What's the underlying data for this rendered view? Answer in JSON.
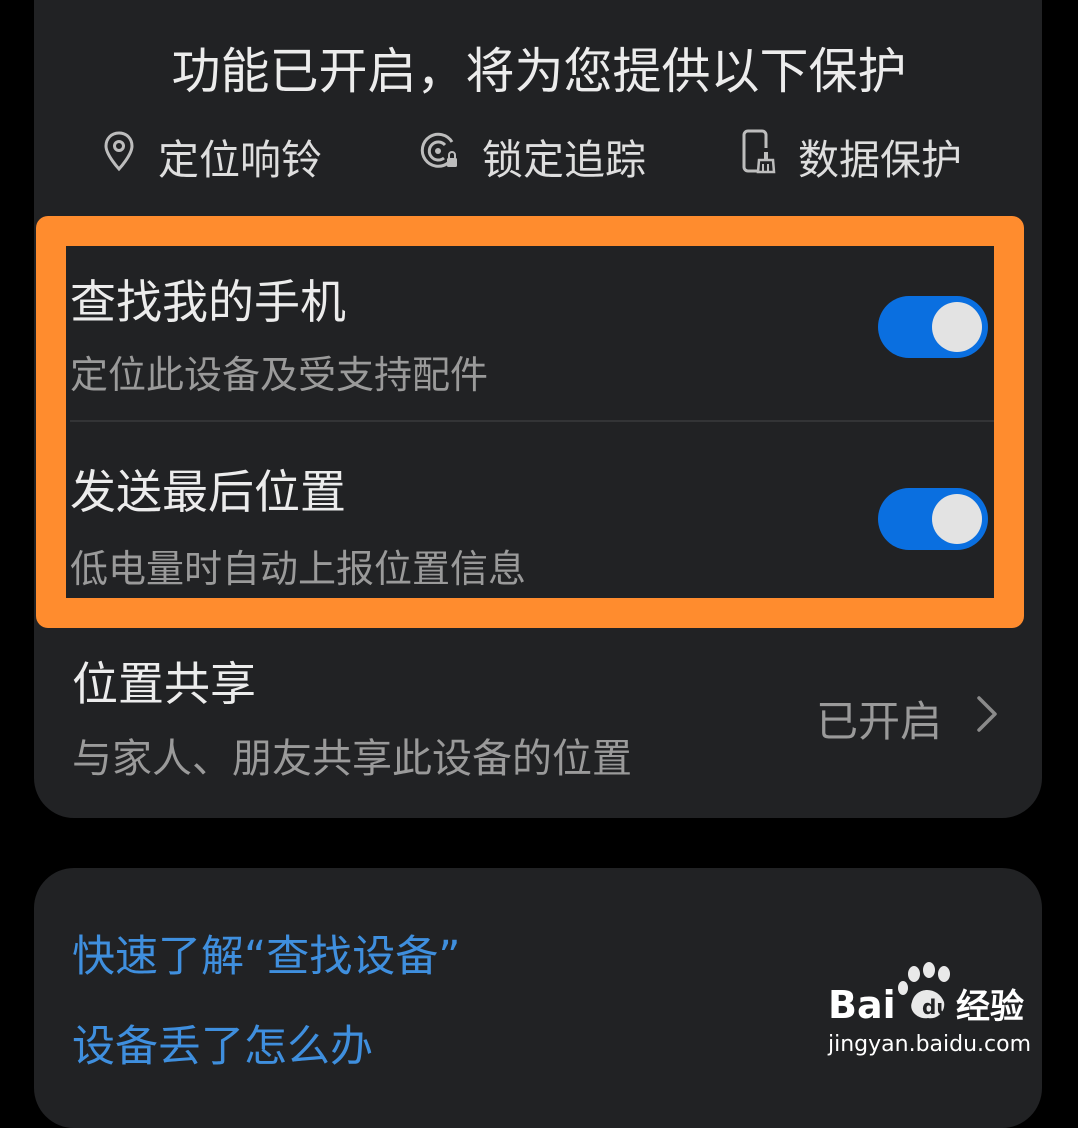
{
  "header": {
    "title": "功能已开启，将为您提供以下保护",
    "features": [
      {
        "label": "定位响铃",
        "icon": "location-pin-icon"
      },
      {
        "label": "锁定追踪",
        "icon": "lock-track-icon"
      },
      {
        "label": "数据保护",
        "icon": "phone-clean-icon"
      }
    ]
  },
  "settings": {
    "find_phone": {
      "title": "查找我的手机",
      "subtitle": "定位此设备及受支持配件",
      "enabled": true
    },
    "send_last_location": {
      "title": "发送最后位置",
      "subtitle": "低电量时自动上报位置信息",
      "enabled": true
    },
    "location_sharing": {
      "title": "位置共享",
      "subtitle": "与家人、朋友共享此设备的位置",
      "status": "已开启"
    }
  },
  "help": {
    "links": [
      "快速了解“查找设备”",
      "设备丢了怎么办"
    ]
  },
  "watermark": {
    "brand": "Bai du 经验",
    "url": "jingyan.baidu.com"
  },
  "colors": {
    "accent": "#0a6fe0",
    "highlight": "#ff8c2e",
    "link": "#3f8fde",
    "card": "#212224",
    "background": "#000000"
  }
}
